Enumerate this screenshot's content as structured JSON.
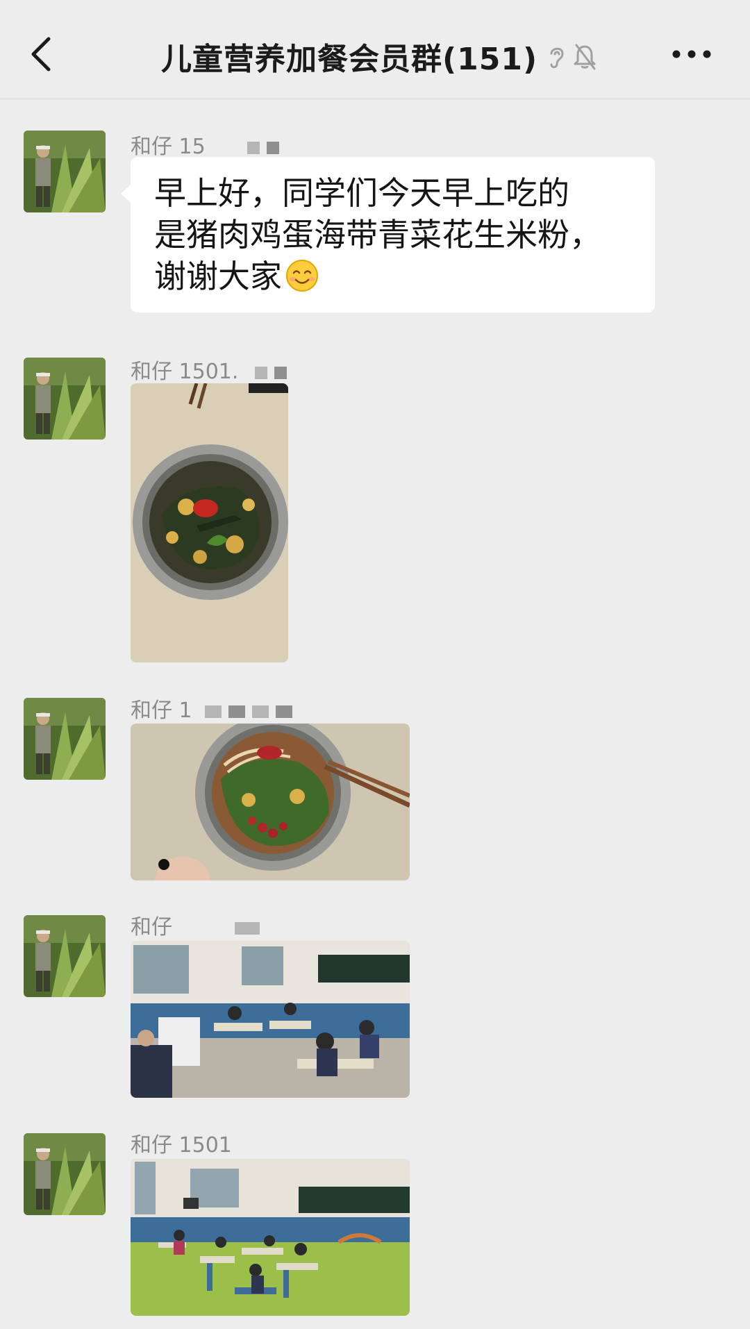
{
  "header": {
    "title": "儿童营养加餐会员群(151)",
    "back_icon": "chevron-left-icon",
    "ear_icon": "ear-icon",
    "mute_icon": "bell-muted-icon",
    "more_icon": "more-dots-icon"
  },
  "messages": [
    {
      "sender": "和仔 15",
      "type": "text",
      "text_lines": [
        "早上好，同学们今天早上吃的",
        "是猪肉鸡蛋海带青菜花生米粉，",
        "谢谢大家"
      ],
      "emoji": "smiling-face-icon"
    },
    {
      "sender": "和仔 1501.",
      "type": "image",
      "image": "bowl-of-noodles-photo"
    },
    {
      "sender": "和仔 1",
      "type": "image",
      "image": "noodles-with-chopsticks-photo"
    },
    {
      "sender": "和仔",
      "type": "image",
      "image": "classroom-photo"
    },
    {
      "sender": "和仔 1501",
      "type": "image",
      "image": "classroom-photo-2"
    }
  ],
  "colors": {
    "background": "#ededed",
    "bubble": "#ffffff",
    "sender_text": "#8a8a8a"
  }
}
